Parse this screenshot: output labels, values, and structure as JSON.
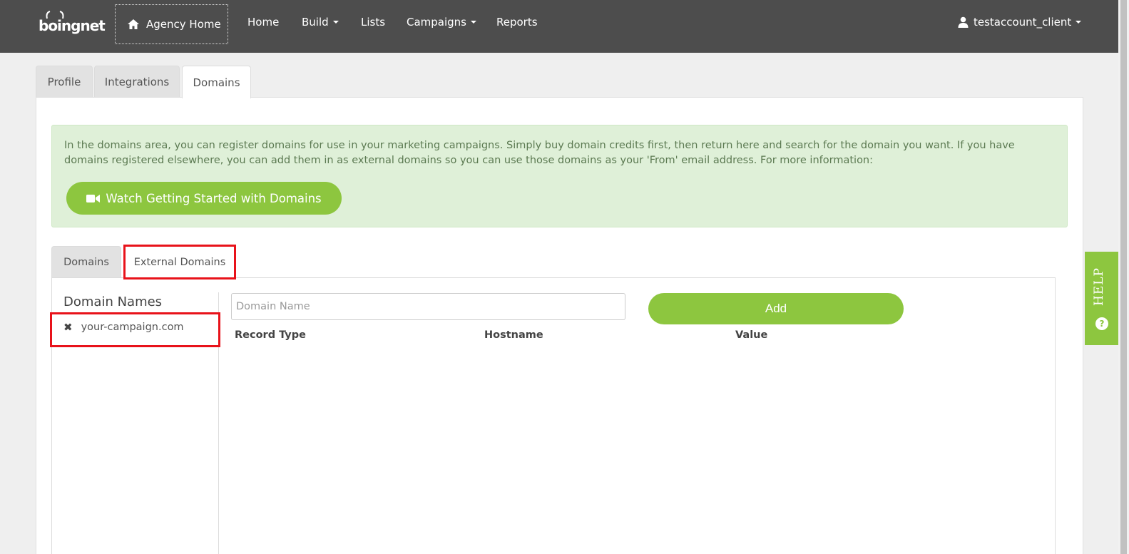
{
  "brand": {
    "logo_text": "boingnet"
  },
  "nav": {
    "agency_home": "Agency Home",
    "items": [
      "Home",
      "Build",
      "Lists",
      "Campaigns",
      "Reports"
    ],
    "user": "testaccount_client"
  },
  "top_tabs": [
    "Profile",
    "Integrations",
    "Domains"
  ],
  "alert": {
    "text": "In the domains area, you can register domains for use in your marketing campaigns. Simply buy domain credits first, then return here and search for the domain you want. If you have domains registered elsewhere, you can add them in as external domains so you can use those domains as your 'From' email address. For more information:",
    "button": "Watch Getting Started with Domains"
  },
  "inner_tabs": [
    "Domains",
    "External Domains"
  ],
  "domain_list": {
    "title": "Domain Names",
    "items": [
      "your-campaign.com"
    ]
  },
  "form": {
    "placeholder": "Domain Name",
    "add_label": "Add"
  },
  "columns": [
    "Record Type",
    "Hostname",
    "Value"
  ],
  "help": {
    "label": "HELP",
    "icon": "?"
  },
  "colors": {
    "accent": "#8dc63f",
    "topbar": "#4d4d4d",
    "highlight": "#e8121a",
    "alert_bg": "#dff0d8"
  }
}
